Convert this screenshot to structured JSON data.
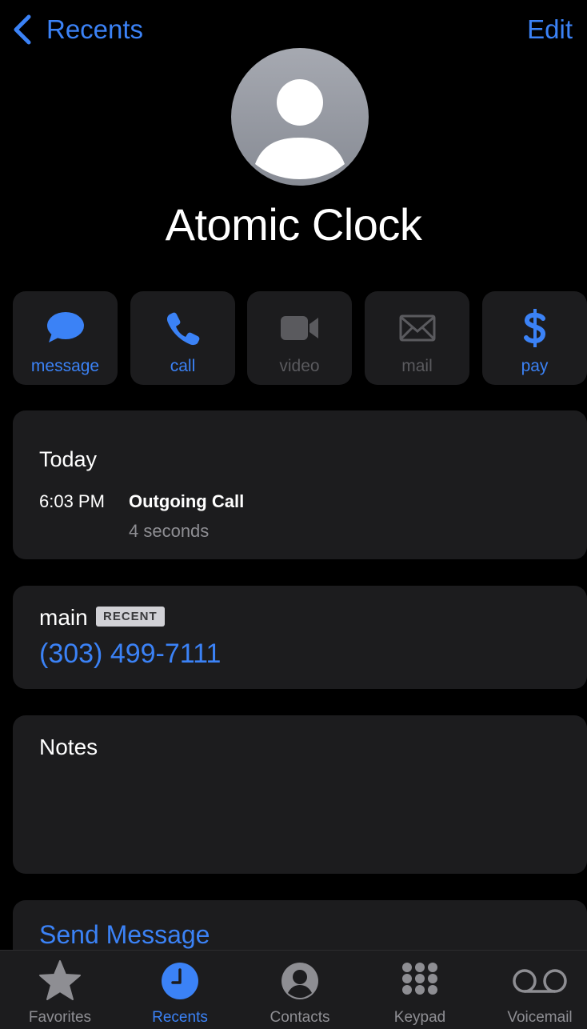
{
  "nav": {
    "back_label": "Recents",
    "edit_label": "Edit"
  },
  "contact": {
    "name": "Atomic Clock"
  },
  "actions": [
    {
      "label": "message",
      "icon": "message-bubble-icon",
      "enabled": true
    },
    {
      "label": "call",
      "icon": "phone-icon",
      "enabled": true
    },
    {
      "label": "video",
      "icon": "video-camera-icon",
      "enabled": false
    },
    {
      "label": "mail",
      "icon": "envelope-icon",
      "enabled": false
    },
    {
      "label": "pay",
      "icon": "dollar-icon",
      "enabled": true
    }
  ],
  "history": {
    "date": "Today",
    "entries": [
      {
        "time": "6:03 PM",
        "type": "Outgoing Call",
        "duration": "4 seconds"
      }
    ]
  },
  "phone": {
    "label": "main",
    "badge": "RECENT",
    "number": "(303) 499-7111"
  },
  "notes": {
    "label": "Notes"
  },
  "send_message": {
    "label": "Send Message"
  },
  "tabbar": {
    "active": "Recents",
    "tabs": [
      {
        "label": "Favorites",
        "icon": "star-icon"
      },
      {
        "label": "Recents",
        "icon": "clock-icon"
      },
      {
        "label": "Contacts",
        "icon": "person-circle-icon"
      },
      {
        "label": "Keypad",
        "icon": "keypad-icon"
      },
      {
        "label": "Voicemail",
        "icon": "voicemail-icon"
      }
    ]
  },
  "colors": {
    "accent": "#3b82f6",
    "background": "#000000",
    "card": "#1c1c1e",
    "secondary_text": "#8e8e93",
    "disabled": "#5a5a5e"
  }
}
